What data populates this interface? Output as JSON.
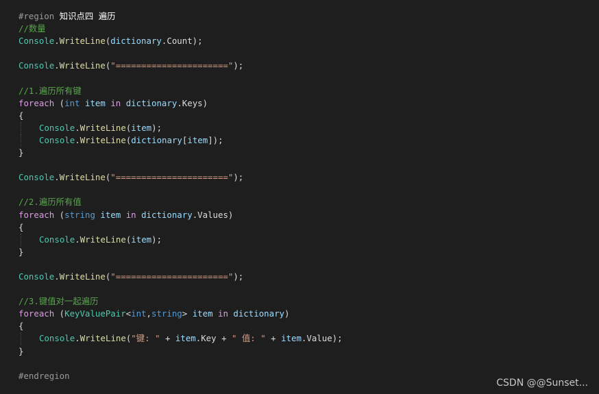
{
  "editor": {
    "lines": [
      {
        "tokens": [
          {
            "t": "#region ",
            "c": "region"
          },
          {
            "t": "知识点四 遍历",
            "c": "region-label"
          }
        ]
      },
      {
        "tokens": [
          {
            "t": "//数量",
            "c": "comment"
          }
        ]
      },
      {
        "tokens": [
          {
            "t": "Console",
            "c": "type"
          },
          {
            "t": ".",
            "c": "punc"
          },
          {
            "t": "WriteLine",
            "c": "method"
          },
          {
            "t": "(",
            "c": "punc"
          },
          {
            "t": "dictionary",
            "c": "var"
          },
          {
            "t": ".Count);",
            "c": "punc"
          }
        ]
      },
      {
        "tokens": []
      },
      {
        "tokens": [
          {
            "t": "Console",
            "c": "type"
          },
          {
            "t": ".",
            "c": "punc"
          },
          {
            "t": "WriteLine",
            "c": "method"
          },
          {
            "t": "(",
            "c": "punc"
          },
          {
            "t": "\"======================\"",
            "c": "string"
          },
          {
            "t": ");",
            "c": "punc"
          }
        ]
      },
      {
        "tokens": []
      },
      {
        "tokens": [
          {
            "t": "//1.遍历所有键",
            "c": "comment"
          }
        ]
      },
      {
        "tokens": [
          {
            "t": "foreach",
            "c": "control"
          },
          {
            "t": " (",
            "c": "punc"
          },
          {
            "t": "int",
            "c": "keyword"
          },
          {
            "t": " ",
            "c": "punc"
          },
          {
            "t": "item",
            "c": "var"
          },
          {
            "t": " ",
            "c": "punc"
          },
          {
            "t": "in",
            "c": "control"
          },
          {
            "t": " ",
            "c": "punc"
          },
          {
            "t": "dictionary",
            "c": "var"
          },
          {
            "t": ".Keys)",
            "c": "punc"
          }
        ]
      },
      {
        "tokens": [
          {
            "t": "{",
            "c": "punc"
          }
        ]
      },
      {
        "indent": true,
        "tokens": [
          {
            "t": "Console",
            "c": "type"
          },
          {
            "t": ".",
            "c": "punc"
          },
          {
            "t": "WriteLine",
            "c": "method"
          },
          {
            "t": "(",
            "c": "punc"
          },
          {
            "t": "item",
            "c": "var"
          },
          {
            "t": ");",
            "c": "punc"
          }
        ]
      },
      {
        "indent": true,
        "tokens": [
          {
            "t": "Console",
            "c": "type"
          },
          {
            "t": ".",
            "c": "punc"
          },
          {
            "t": "WriteLine",
            "c": "method"
          },
          {
            "t": "(",
            "c": "punc"
          },
          {
            "t": "dictionary",
            "c": "var"
          },
          {
            "t": "[",
            "c": "punc"
          },
          {
            "t": "item",
            "c": "var"
          },
          {
            "t": "]);",
            "c": "punc"
          }
        ]
      },
      {
        "tokens": [
          {
            "t": "}",
            "c": "punc"
          }
        ]
      },
      {
        "tokens": []
      },
      {
        "tokens": [
          {
            "t": "Console",
            "c": "type"
          },
          {
            "t": ".",
            "c": "punc"
          },
          {
            "t": "WriteLine",
            "c": "method"
          },
          {
            "t": "(",
            "c": "punc"
          },
          {
            "t": "\"======================\"",
            "c": "string"
          },
          {
            "t": ");",
            "c": "punc"
          }
        ]
      },
      {
        "tokens": []
      },
      {
        "tokens": [
          {
            "t": "//2.遍历所有值",
            "c": "comment"
          }
        ]
      },
      {
        "tokens": [
          {
            "t": "foreach",
            "c": "control"
          },
          {
            "t": " (",
            "c": "punc"
          },
          {
            "t": "string",
            "c": "keyword"
          },
          {
            "t": " ",
            "c": "punc"
          },
          {
            "t": "item",
            "c": "var"
          },
          {
            "t": " ",
            "c": "punc"
          },
          {
            "t": "in",
            "c": "control"
          },
          {
            "t": " ",
            "c": "punc"
          },
          {
            "t": "dictionary",
            "c": "var"
          },
          {
            "t": ".Values)",
            "c": "punc"
          }
        ]
      },
      {
        "tokens": [
          {
            "t": "{",
            "c": "punc"
          }
        ]
      },
      {
        "indent": true,
        "tokens": [
          {
            "t": "Console",
            "c": "type"
          },
          {
            "t": ".",
            "c": "punc"
          },
          {
            "t": "WriteLine",
            "c": "method"
          },
          {
            "t": "(",
            "c": "punc"
          },
          {
            "t": "item",
            "c": "var"
          },
          {
            "t": ");",
            "c": "punc"
          }
        ]
      },
      {
        "tokens": [
          {
            "t": "}",
            "c": "punc"
          }
        ]
      },
      {
        "tokens": []
      },
      {
        "tokens": [
          {
            "t": "Console",
            "c": "type"
          },
          {
            "t": ".",
            "c": "punc"
          },
          {
            "t": "WriteLine",
            "c": "method"
          },
          {
            "t": "(",
            "c": "punc"
          },
          {
            "t": "\"======================\"",
            "c": "string"
          },
          {
            "t": ");",
            "c": "punc"
          }
        ]
      },
      {
        "tokens": []
      },
      {
        "tokens": [
          {
            "t": "//3.键值对一起遍历",
            "c": "comment"
          }
        ]
      },
      {
        "tokens": [
          {
            "t": "foreach",
            "c": "control"
          },
          {
            "t": " (",
            "c": "punc"
          },
          {
            "t": "KeyValuePair",
            "c": "type"
          },
          {
            "t": "<",
            "c": "punc"
          },
          {
            "t": "int",
            "c": "keyword"
          },
          {
            "t": ",",
            "c": "punc"
          },
          {
            "t": "string",
            "c": "keyword"
          },
          {
            "t": "> ",
            "c": "punc"
          },
          {
            "t": "item",
            "c": "var"
          },
          {
            "t": " ",
            "c": "punc"
          },
          {
            "t": "in",
            "c": "control"
          },
          {
            "t": " ",
            "c": "punc"
          },
          {
            "t": "dictionary",
            "c": "var"
          },
          {
            "t": ")",
            "c": "punc"
          }
        ]
      },
      {
        "tokens": [
          {
            "t": "{",
            "c": "punc"
          }
        ]
      },
      {
        "indent": true,
        "tokens": [
          {
            "t": "Console",
            "c": "type"
          },
          {
            "t": ".",
            "c": "punc"
          },
          {
            "t": "WriteLine",
            "c": "method"
          },
          {
            "t": "(",
            "c": "punc"
          },
          {
            "t": "\"键: \"",
            "c": "string"
          },
          {
            "t": " + ",
            "c": "punc"
          },
          {
            "t": "item",
            "c": "var"
          },
          {
            "t": ".Key + ",
            "c": "punc"
          },
          {
            "t": "\" 值: \"",
            "c": "string"
          },
          {
            "t": " + ",
            "c": "punc"
          },
          {
            "t": "item",
            "c": "var"
          },
          {
            "t": ".Value);",
            "c": "punc"
          }
        ]
      },
      {
        "tokens": [
          {
            "t": "}",
            "c": "punc"
          }
        ]
      },
      {
        "tokens": []
      },
      {
        "tokens": [
          {
            "t": "#endregion",
            "c": "region"
          }
        ]
      }
    ]
  },
  "watermark": "CSDN @@Sunset..."
}
